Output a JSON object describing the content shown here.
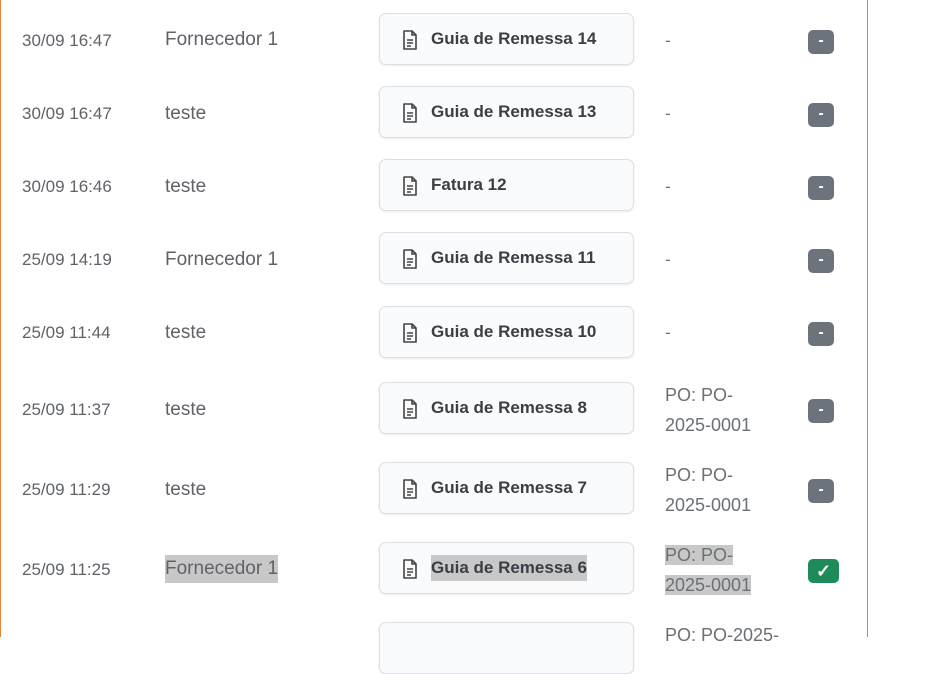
{
  "rows": [
    {
      "date": "30/09 16:47",
      "supplier": "Fornecedor 1",
      "document": "Guia de Remessa 14",
      "po": "-",
      "status": "-"
    },
    {
      "date": "30/09 16:47",
      "supplier": "teste",
      "document": "Guia de Remessa 13",
      "po": "-",
      "status": "-"
    },
    {
      "date": "30/09 16:46",
      "supplier": "teste",
      "document": "Fatura 12",
      "po": "-",
      "status": "-"
    },
    {
      "date": "25/09 14:19",
      "supplier": "Fornecedor 1",
      "document": "Guia de Remessa 11",
      "po": "-",
      "status": "-"
    },
    {
      "date": "25/09 11:44",
      "supplier": "teste",
      "document": "Guia de Remessa 10",
      "po": "-",
      "status": "-"
    },
    {
      "date": "25/09 11:37",
      "supplier": "teste",
      "document": "Guia de Remessa 8",
      "po": "PO: PO-2025-0001",
      "status": "-"
    },
    {
      "date": "25/09 11:29",
      "supplier": "teste",
      "document": "Guia de Remessa 7",
      "po": "PO: PO-2025-0001",
      "status": "-"
    },
    {
      "date": "25/09 11:25",
      "supplier": "Fornecedor 1",
      "document": "Guia de Remessa 6",
      "po": "PO: PO-2025-0001",
      "status": "✓"
    },
    {
      "date": "",
      "supplier": "",
      "document": "",
      "po": "PO: PO-2025-",
      "status": ""
    }
  ],
  "colors": {
    "accent_border": "#e0863e",
    "badge_neutral": "#6c737b",
    "badge_success": "#1f8a5a"
  },
  "icons": {
    "document": "document-icon"
  }
}
